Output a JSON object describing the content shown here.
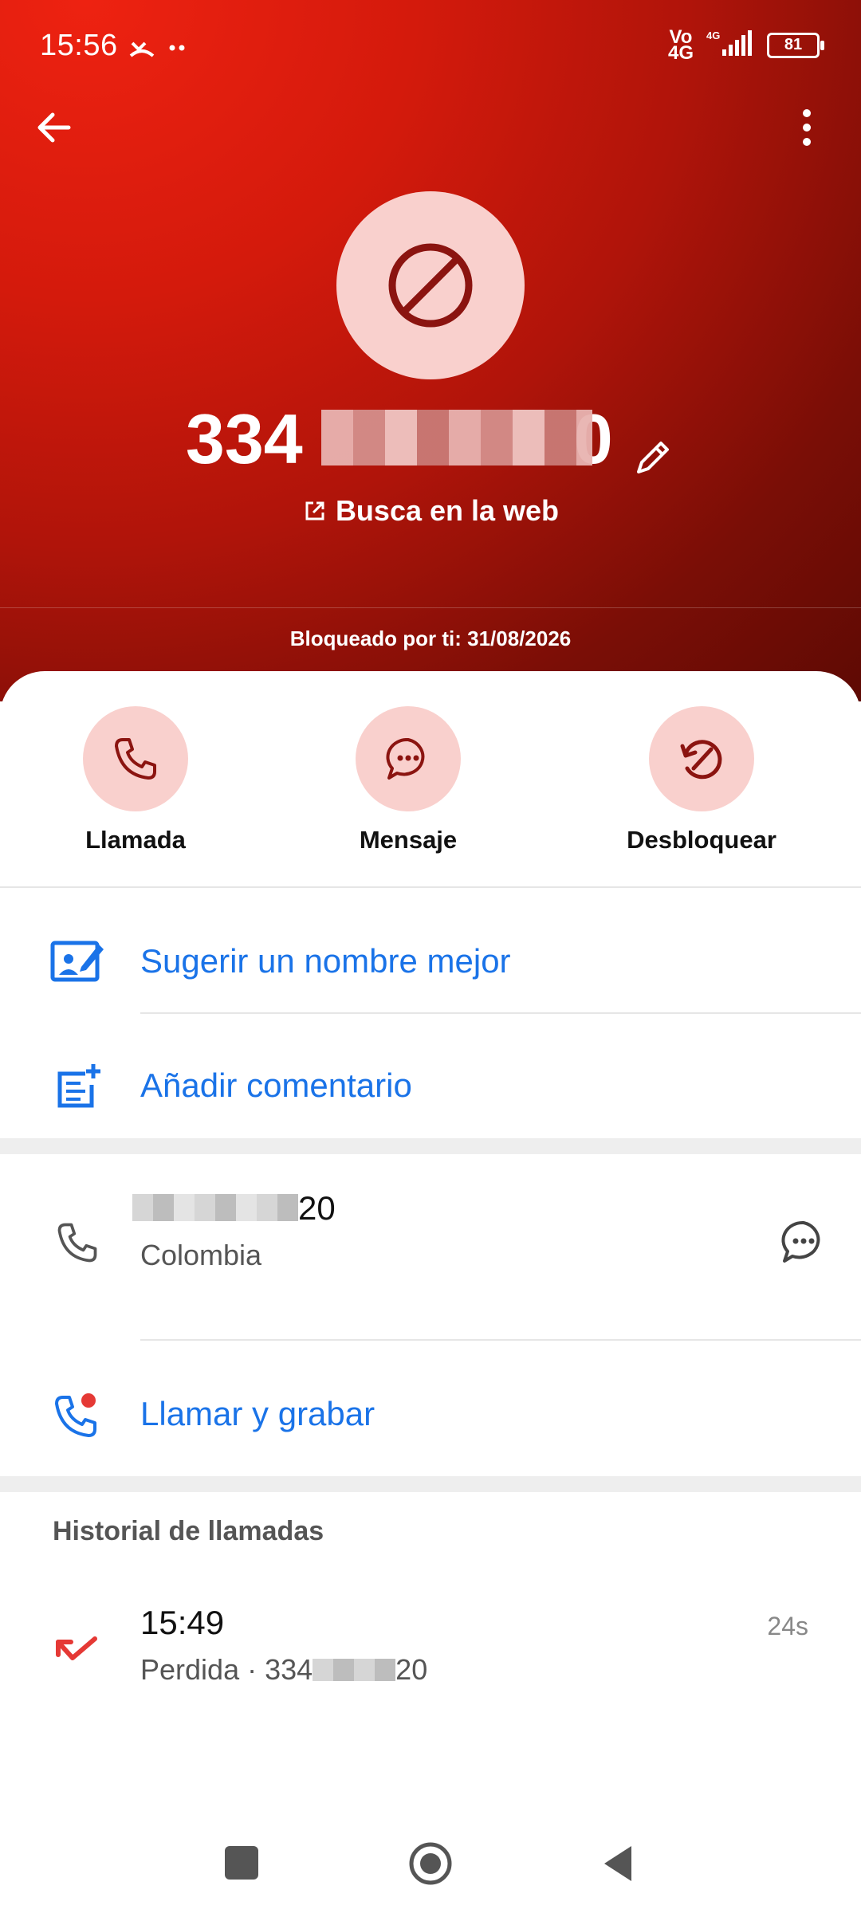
{
  "status": {
    "time": "15:56",
    "volte": "Vo\n4G",
    "network": "4G",
    "battery": "81"
  },
  "header": {
    "number_prefix": "334",
    "number_suffix": "0",
    "web_label": "Busca en la web",
    "blocked_text": "Bloqueado por ti: 31/08/2026"
  },
  "actions": [
    {
      "label": "Llamada",
      "icon": "phone-icon"
    },
    {
      "label": "Mensaje",
      "icon": "message-icon"
    },
    {
      "label": "Desbloquear",
      "icon": "unblock-icon"
    }
  ],
  "menu": {
    "suggest_name": "Sugerir un nombre mejor",
    "add_comment": "Añadir comentario"
  },
  "phone_entry": {
    "number_visible": "20",
    "location": "Colombia",
    "call_record": "Llamar y grabar"
  },
  "history": {
    "title": "Historial de llamadas",
    "items": [
      {
        "time": "15:49",
        "type": "Perdida",
        "number_prefix": "334",
        "number_suffix": "20",
        "duration": "24s"
      }
    ]
  },
  "colors": {
    "accent_blue": "#1a73e8",
    "header_red": "#c4170b",
    "pink_circle": "#f9d0cd",
    "missed_red": "#e53935"
  }
}
